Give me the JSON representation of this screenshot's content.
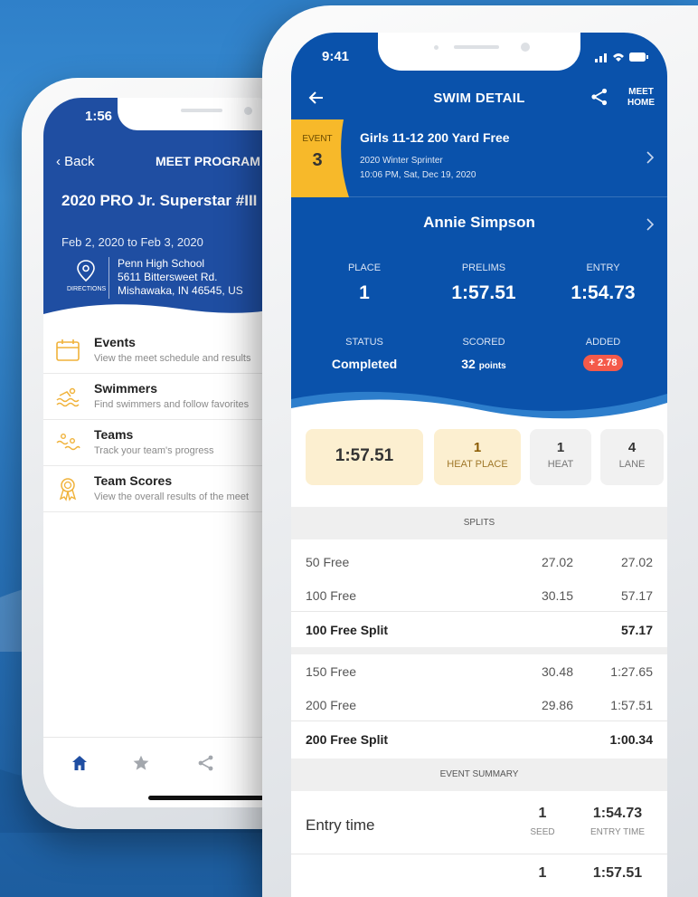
{
  "back_phone": {
    "time": "1:56",
    "back_label": "Back",
    "title": "MEET PROGRAM",
    "meet_name": "2020 PRO Jr. Superstar #III",
    "dates": "Feb 2, 2020 to Feb 3, 2020",
    "directions_label": "DIRECTIONS",
    "address": [
      "Penn High School",
      "5611 Bittersweet Rd.",
      "Mishawaka, IN 46545, US"
    ],
    "menu": [
      {
        "title": "Events",
        "subtitle": "View the meet schedule and results",
        "icon": "calendar-icon"
      },
      {
        "title": "Swimmers",
        "subtitle": "Find swimmers and follow favorites",
        "icon": "swimmer-icon"
      },
      {
        "title": "Teams",
        "subtitle": "Track your team's progress",
        "icon": "teams-icon"
      },
      {
        "title": "Team Scores",
        "subtitle": "View the overall results of the meet",
        "icon": "ribbon-icon"
      }
    ],
    "tabs": [
      "home-icon",
      "star-icon",
      "share-icon"
    ]
  },
  "front_phone": {
    "time": "9:41",
    "title": "SWIM DETAIL",
    "meet_home_label": [
      "MEET",
      "HOME"
    ],
    "event": {
      "label": "EVENT",
      "number": "3",
      "name": "Girls 11-12 200 Yard Free",
      "meet": "2020 Winter Sprinter",
      "datetime": "10:06 PM, Sat, Dec 19, 2020"
    },
    "swimmer": "Annie Simpson",
    "stats": {
      "place_label": "PLACE",
      "place": "1",
      "prelims_label": "PRELIMS",
      "prelims": "1:57.51",
      "entry_label": "ENTRY",
      "entry": "1:54.73",
      "status_label": "STATUS",
      "status": "Completed",
      "scored_label": "SCORED",
      "scored": "32",
      "scored_unit": "points",
      "added_label": "ADDED",
      "added": "+ 2.78"
    },
    "cards": {
      "time": "1:57.51",
      "heat_place": "1",
      "heat_place_label": "HEAT PLACE",
      "heat": "1",
      "heat_label": "HEAT",
      "lane": "4",
      "lane_label": "LANE"
    },
    "splits_label": "SPLITS",
    "splits": [
      {
        "name": "50 Free",
        "split": "27.02",
        "cumulative": "27.02"
      },
      {
        "name": "100 Free",
        "split": "30.15",
        "cumulative": "57.17"
      },
      {
        "name": "100 Free Split",
        "split": "",
        "cumulative": "57.17"
      },
      {
        "name": "150 Free",
        "split": "30.48",
        "cumulative": "1:27.65"
      },
      {
        "name": "200 Free",
        "split": "29.86",
        "cumulative": "1:57.51"
      },
      {
        "name": "200 Free Split",
        "split": "",
        "cumulative": "1:00.34"
      }
    ],
    "summary_label": "EVENT SUMMARY",
    "summary": [
      {
        "name": "Entry time",
        "seed": "1",
        "seed_label": "SEED",
        "time": "1:54.73",
        "time_label": "ENTRY TIME"
      },
      {
        "name": "",
        "seed": "1",
        "seed_label": "",
        "time": "1:57.51",
        "time_label": ""
      }
    ]
  },
  "colors": {
    "primary_blue": "#0a52ab",
    "back_blue": "#1f4ea2",
    "event_yellow": "#f7b92a",
    "card_cream": "#fcefd0",
    "added_red": "#f45a4a"
  }
}
